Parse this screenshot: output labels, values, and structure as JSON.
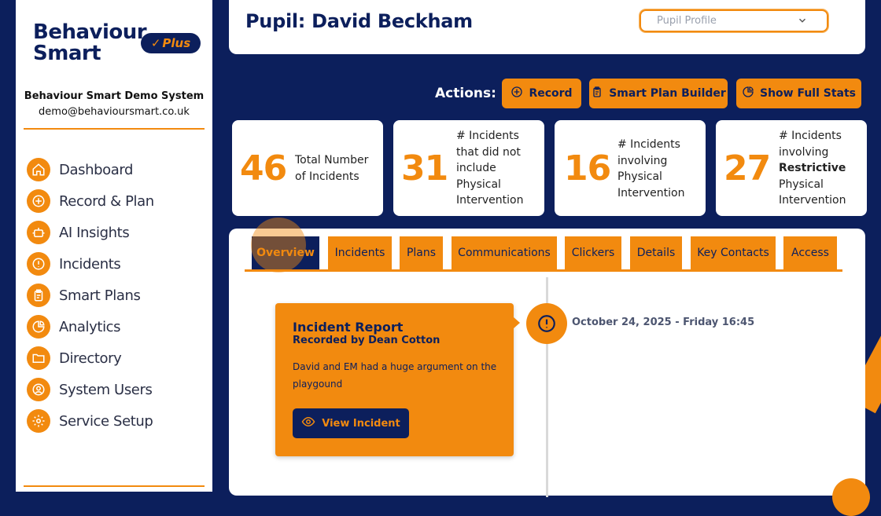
{
  "brand": {
    "line1": "Behaviour",
    "line2": "Smart",
    "plus_label": "Plus"
  },
  "system": {
    "name": "Behaviour Smart Demo System",
    "email": "demo@behavioursmart.co.uk"
  },
  "nav": {
    "items": [
      {
        "label": "Dashboard",
        "icon": "home-icon"
      },
      {
        "label": "Record & Plan",
        "icon": "plus-circle-icon"
      },
      {
        "label": "AI Insights",
        "icon": "robot-icon"
      },
      {
        "label": "Incidents",
        "icon": "alert-icon"
      },
      {
        "label": "Smart Plans",
        "icon": "clipboard-icon"
      },
      {
        "label": "Analytics",
        "icon": "pie-chart-icon"
      },
      {
        "label": "Directory",
        "icon": "folder-icon"
      },
      {
        "label": "System Users",
        "icon": "user-icon"
      },
      {
        "label": "Service Setup",
        "icon": "gear-icon"
      }
    ]
  },
  "header": {
    "title": "Pupil: David Beckham",
    "select_value": "Pupil Profile"
  },
  "actions": {
    "label": "Actions:",
    "record": "Record",
    "plan_builder": "Smart Plan Builder",
    "full_stats": "Show Full Stats"
  },
  "stats": [
    {
      "value": "46",
      "desc": [
        "Total Number",
        "of Incidents"
      ]
    },
    {
      "value": "31",
      "desc": [
        "# Incidents",
        "that did not",
        "include",
        "Physical",
        "Intervention"
      ]
    },
    {
      "value": "16",
      "desc": [
        "# Incidents",
        "involving",
        "Physical",
        "Intervention"
      ]
    },
    {
      "value": "27",
      "desc_pre": [
        "# Incidents",
        "involving"
      ],
      "desc_bold": "Restrictive",
      "desc_post": [
        "Physical",
        "Intervention"
      ]
    }
  ],
  "tabs": [
    "Overview",
    "Incidents",
    "Plans",
    "Communications",
    "Clickers",
    "Details",
    "Key Contacts",
    "Access"
  ],
  "timeline": {
    "date": "October 24, 2025 - Friday 16:45",
    "card": {
      "title": "Incident Report",
      "subtitle": "Recorded by Dean Cotton",
      "description": "David and EM had a huge argument on the playgound",
      "button": "View Incident"
    }
  },
  "colors": {
    "navy": "#0c1f5c",
    "orange": "#f28a0f"
  }
}
